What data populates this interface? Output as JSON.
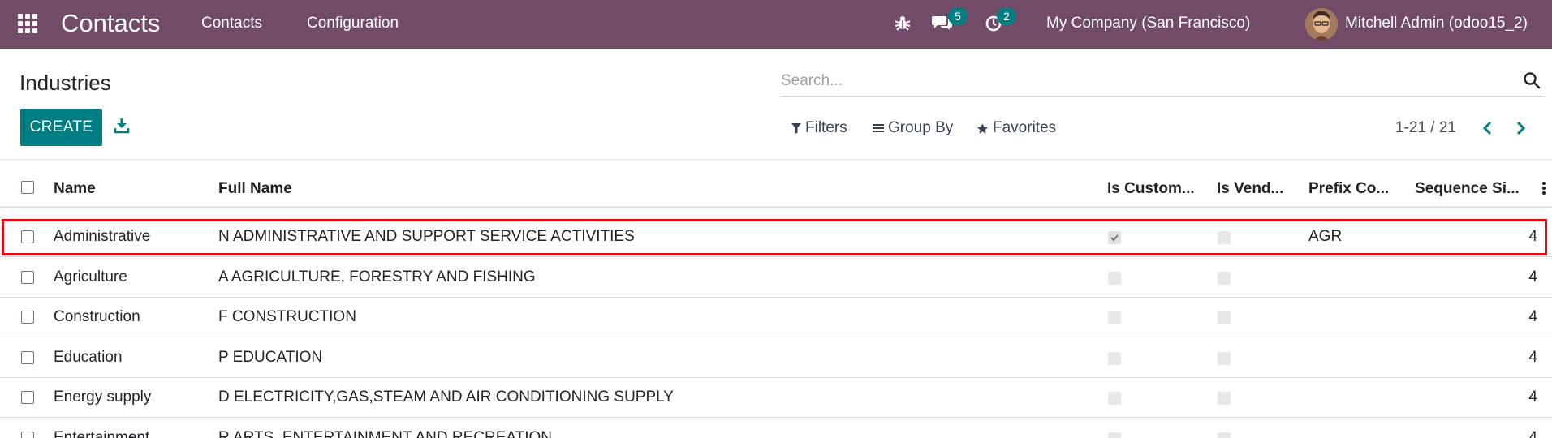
{
  "navbar": {
    "app_name": "Contacts",
    "menu": [
      "Contacts",
      "Configuration"
    ],
    "messages_count": "5",
    "activities_count": "2",
    "company": "My Company (San Francisco)",
    "user": "Mitchell Admin (odoo15_2)",
    "icons": [
      "apps-grid-icon",
      "bug-icon",
      "chat-icon",
      "clock-icon"
    ],
    "bg_color": "#714b67",
    "badge_color": "#017e84"
  },
  "control_panel": {
    "title": "Industries",
    "search_placeholder": "Search...",
    "create_label": "CREATE",
    "filters_label": "Filters",
    "group_by_label": "Group By",
    "favorites_label": "Favorites",
    "pager": "1-21 / 21"
  },
  "table": {
    "columns": [
      "Name",
      "Full Name",
      "Is Custom...",
      "Is Vend...",
      "Prefix Co...",
      "Sequence Si..."
    ],
    "rows": [
      {
        "name": "Administrative",
        "full_name": "N ADMINISTRATIVE AND SUPPORT SERVICE ACTIVITIES",
        "is_customer": true,
        "is_vendor": false,
        "prefix": "AGR",
        "sequence": "4"
      },
      {
        "name": "Agriculture",
        "full_name": "A AGRICULTURE, FORESTRY AND FISHING",
        "is_customer": false,
        "is_vendor": false,
        "prefix": "",
        "sequence": "4"
      },
      {
        "name": "Construction",
        "full_name": "F CONSTRUCTION",
        "is_customer": false,
        "is_vendor": false,
        "prefix": "",
        "sequence": "4"
      },
      {
        "name": "Education",
        "full_name": "P EDUCATION",
        "is_customer": false,
        "is_vendor": false,
        "prefix": "",
        "sequence": "4"
      },
      {
        "name": "Energy supply",
        "full_name": "D ELECTRICITY,GAS,STEAM AND AIR CONDITIONING SUPPLY",
        "is_customer": false,
        "is_vendor": false,
        "prefix": "",
        "sequence": "4"
      },
      {
        "name": "Entertainment",
        "full_name": "R ARTS, ENTERTAINMENT AND RECREATION",
        "is_customer": false,
        "is_vendor": false,
        "prefix": "",
        "sequence": "4"
      }
    ],
    "highlight_color": "#e30613"
  }
}
